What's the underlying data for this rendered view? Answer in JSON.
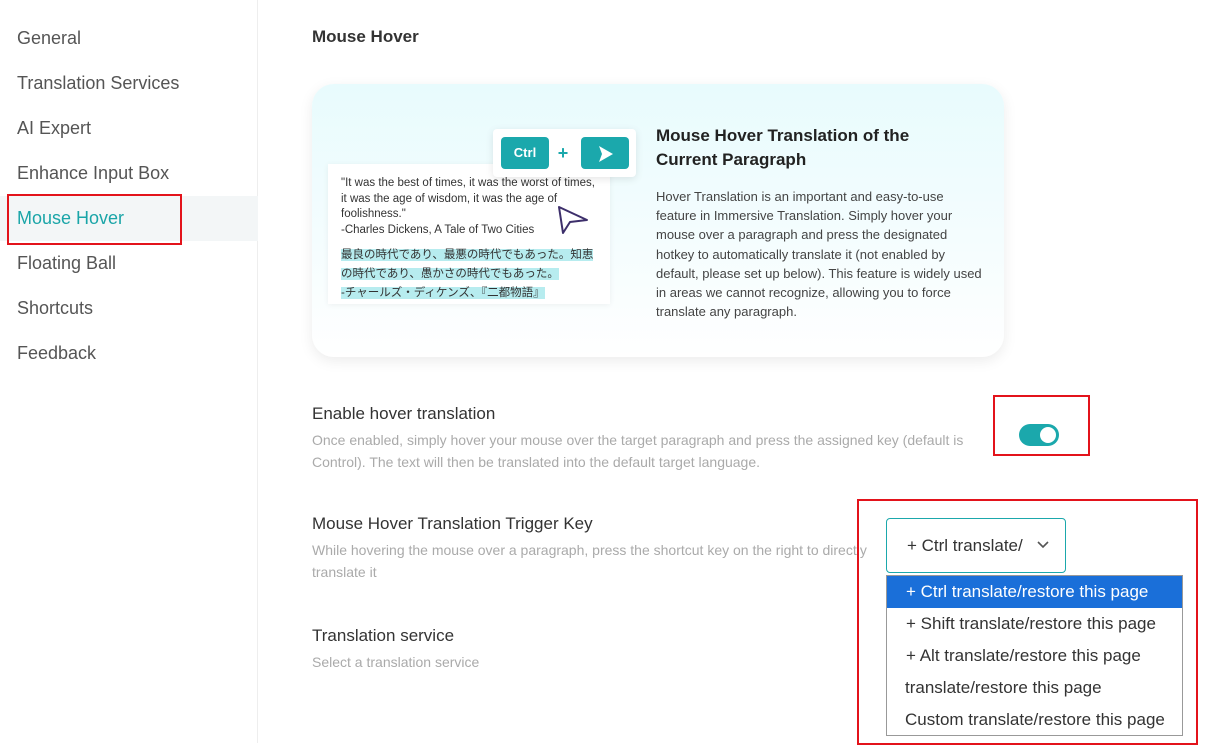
{
  "sidebar": {
    "items": [
      {
        "label": "General"
      },
      {
        "label": "Translation Services"
      },
      {
        "label": "AI Expert"
      },
      {
        "label": "Enhance Input Box"
      },
      {
        "label": "Mouse Hover"
      },
      {
        "label": "Floating Ball"
      },
      {
        "label": "Shortcuts"
      },
      {
        "label": "Feedback"
      }
    ],
    "active": "Mouse Hover"
  },
  "main": {
    "title": "Mouse Hover",
    "hero": {
      "quote_en_1": "\"It was the best of times, it was the worst of times, it was the age of wisdom, it was the age of foolishness.\"",
      "quote_en_2": "-Charles Dickens, A Tale of Two Cities",
      "quote_ja_1": "最良の時代であり、最悪の時代でもあった。知恵",
      "quote_ja_2": "の時代であり、愚かさの時代でもあった。",
      "quote_ja_3": "-チャールズ・ディケンズ、『二都物語』",
      "key_label": "Ctrl",
      "plus": "+",
      "title": "Mouse Hover Translation of the Current Paragraph",
      "description": "Hover Translation is an important and easy-to-use feature in Immersive Translation. Simply hover your mouse over a paragraph and press the designated hotkey to automatically translate it (not enabled by default, please set up below). This feature is widely used in areas we cannot recognize, allowing you to force translate any paragraph."
    },
    "enable": {
      "title": "Enable hover translation",
      "description": "Once enabled, simply hover your mouse over the target paragraph and press the assigned key (default is Control). The text will then be translated into the default target language.",
      "enabled": true
    },
    "trigger": {
      "title": "Mouse Hover Translation Trigger Key",
      "description": "While hovering the mouse over a paragraph, press the shortcut key on the right to directly translate it",
      "selected_value": "+ Ctrl translate/restore this page",
      "options": [
        {
          "label": "+ Ctrl translate/restore this page"
        },
        {
          "label": "+ Shift translate/restore this page"
        },
        {
          "label": "+ Alt translate/restore this page"
        },
        {
          "label": "translate/restore this page"
        },
        {
          "label": "Custom translate/restore this page"
        }
      ]
    },
    "service": {
      "title": "Translation service",
      "description": "Select a translation service"
    }
  },
  "colors": {
    "accent": "#1ba8ac",
    "active_text": "#1aa5a8",
    "highlight_box": "#e3131b",
    "dropdown_selected": "#1a6fd9"
  }
}
